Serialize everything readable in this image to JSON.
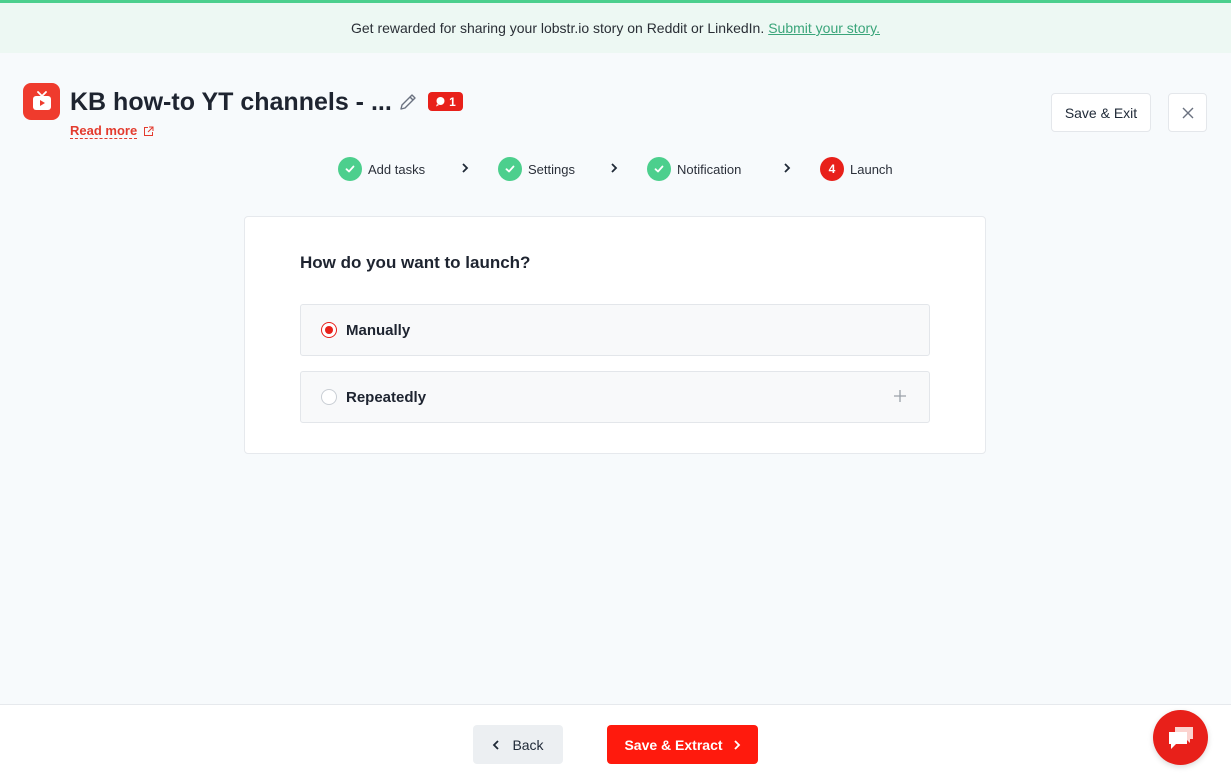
{
  "banner": {
    "text": "Get rewarded for sharing your lobstr.io story on Reddit or LinkedIn.",
    "link": "Submit your story."
  },
  "header": {
    "logo_icon": "youtube-app-icon",
    "title": "KB how-to YT channels - ...",
    "badge_count": "1",
    "read_more": "Read more",
    "save_exit": "Save & Exit",
    "close_icon": "close-icon"
  },
  "steps": [
    {
      "label": "Add tasks",
      "status": "done"
    },
    {
      "label": "Settings",
      "status": "done"
    },
    {
      "label": "Notification",
      "status": "done"
    },
    {
      "label": "Launch",
      "status": "active",
      "number": "4"
    }
  ],
  "launch": {
    "question": "How do you want to launch?",
    "options": [
      {
        "label": "Manually",
        "selected": true
      },
      {
        "label": "Repeatedly",
        "selected": false
      }
    ]
  },
  "footer": {
    "back": "Back",
    "extract": "Save & Extract"
  },
  "colors": {
    "accent": "#e8201a",
    "success": "#4ccf8d",
    "link": "#3aa57a"
  }
}
